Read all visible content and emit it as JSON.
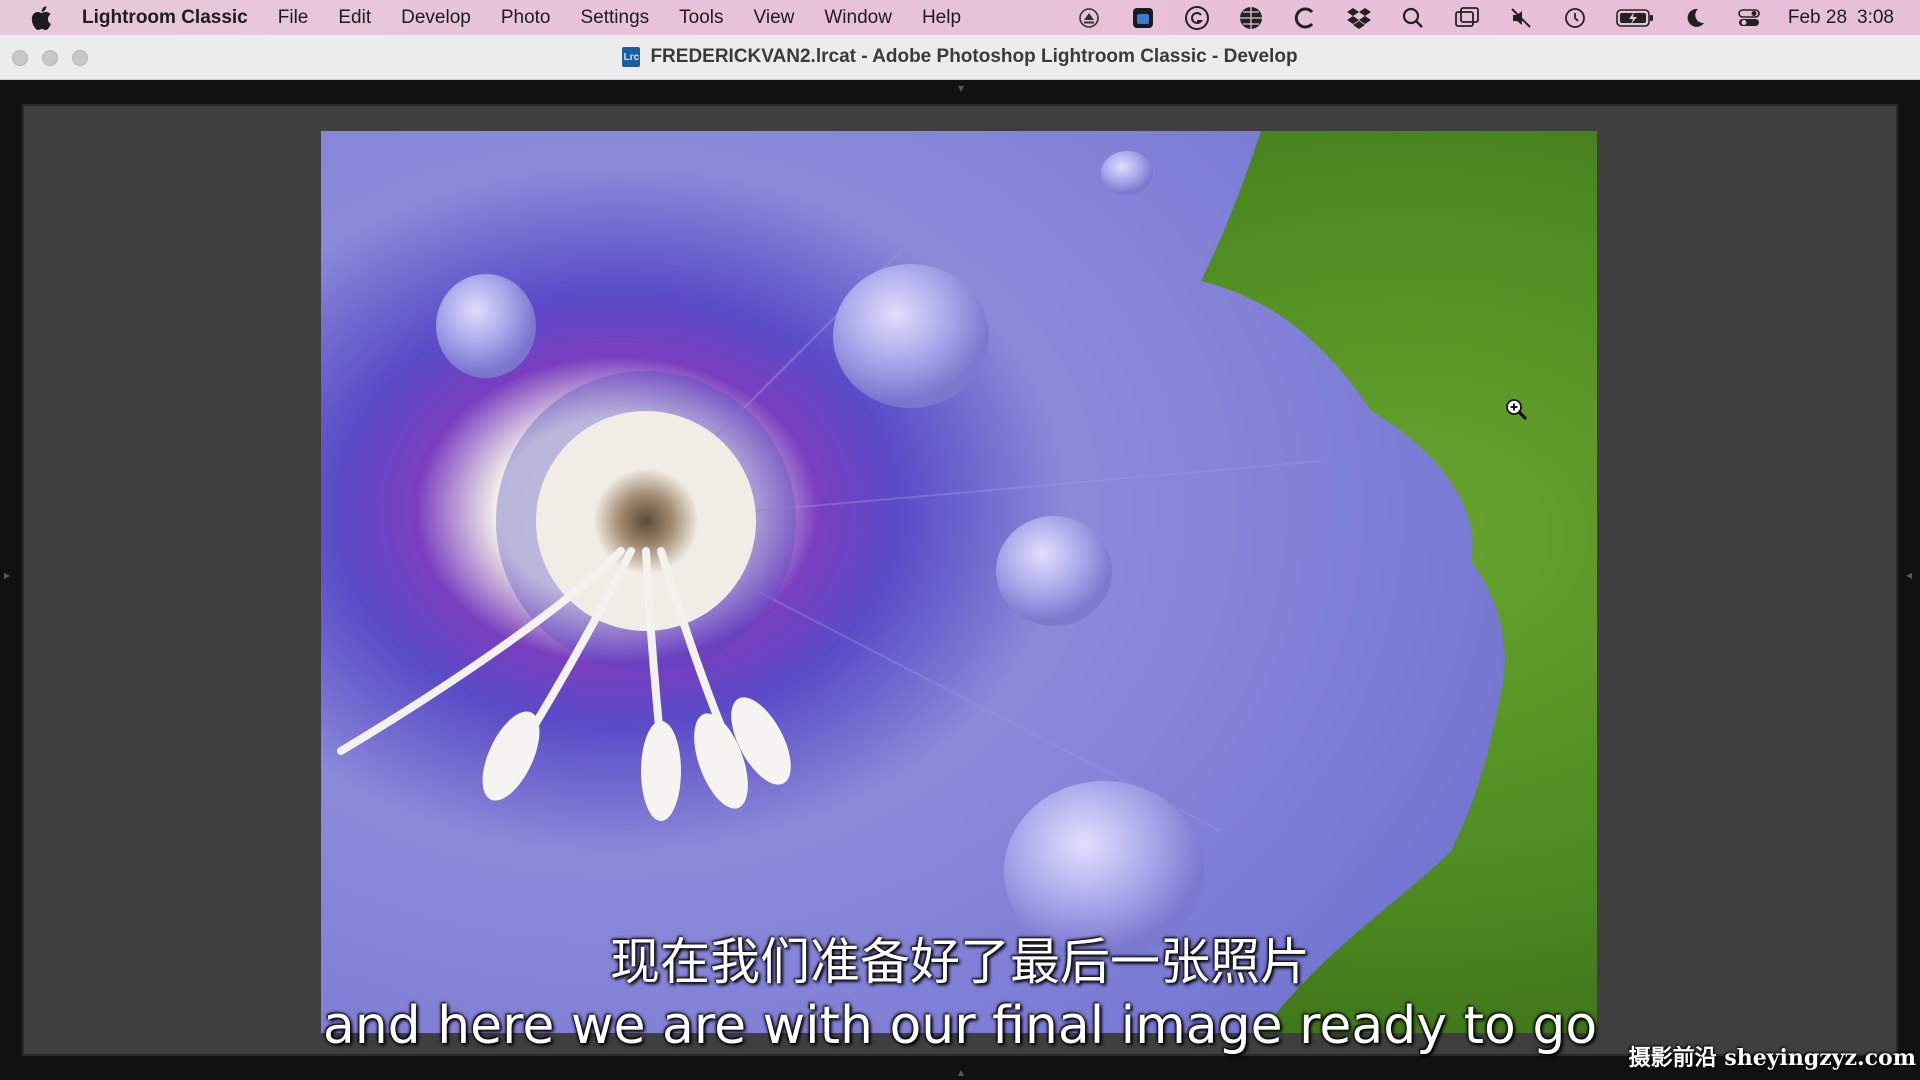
{
  "menubar": {
    "app_name": "Lightroom Classic",
    "items": [
      "File",
      "Edit",
      "Develop",
      "Photo",
      "Settings",
      "Tools",
      "View",
      "Window",
      "Help"
    ],
    "status_icons": [
      "eject-icon",
      "app-icon",
      "grammarly-icon",
      "vpn-globe-icon",
      "c-app-icon",
      "dropbox-icon",
      "spotlight-search-icon",
      "screen-mirroring-icon",
      "mute-icon",
      "time-machine-icon",
      "battery-icon",
      "focus-moon-icon",
      "control-center-icon"
    ],
    "date": "Feb 28",
    "time": "3:08"
  },
  "window": {
    "doc_icon_text": "Lrc",
    "title": "FREDERICKVAN2.lrcat - Adobe Photoshop Lightroom Classic - Develop"
  },
  "subtitles": {
    "zh": "现在我们准备好了最后一张照片",
    "en": "and here we are with our final image ready to go"
  },
  "watermark": "摄影前沿 sheyingzyz.com",
  "colors": {
    "menubar_tint": "#e8c2da",
    "canvas_bg": "#3f3f3f",
    "petal": "#7f7fd6",
    "leaf": "#4f8a22"
  }
}
